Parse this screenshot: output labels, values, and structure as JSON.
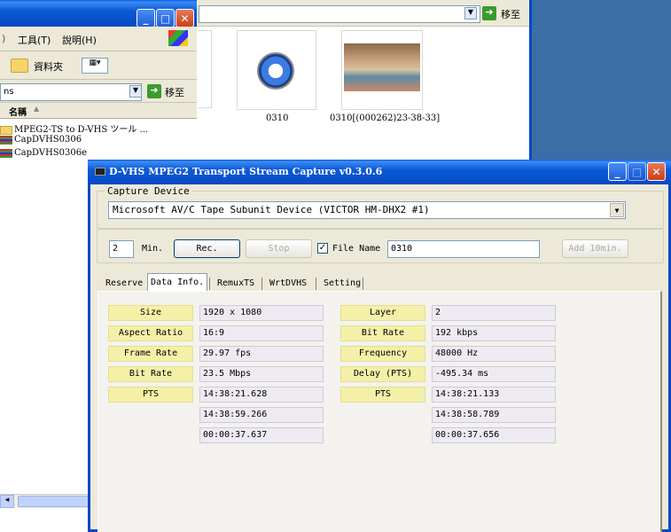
{
  "explorer": {
    "menu": {
      "tools": "工具(T)",
      "help": "說明(H)"
    },
    "toolbar": {
      "folders": "資料夾"
    },
    "address": {
      "value": "ns",
      "go": "移至"
    },
    "list_header": "名稱",
    "items": [
      {
        "label": "MPEG2-TS to D-VHS ツール ..."
      },
      {
        "label": "CapDVHS0306"
      },
      {
        "label": "CapDVHS0306e"
      }
    ]
  },
  "folder_window": {
    "go": "移至",
    "files": [
      {
        "label": "0310"
      },
      {
        "label": "0310[(000262)23-38-33]"
      }
    ]
  },
  "dialog": {
    "title": "D-VHS MPEG2 Transport Stream Capture v0.3.0.6",
    "capture_device": {
      "legend": "Capture Device",
      "value": "Microsoft AV/C Tape Subunit Device (VICTOR HM-DHX2 #1)"
    },
    "controls": {
      "minutes": "2",
      "min_label": "Min.",
      "rec": "Rec.",
      "stop": "Stop",
      "file_name_label": "File Name",
      "file_name_checked": true,
      "file_name_value": "0310",
      "add_10min": "Add 10min."
    },
    "tabs": [
      "Reserve",
      "Data Info.",
      "RemuxTS",
      "WrtDVHS",
      "Setting"
    ],
    "active_tab": "Data Info.",
    "video": {
      "size_label": "Size",
      "size": "1920 x 1080",
      "aspect_label": "Aspect Ratio",
      "aspect": "16:9",
      "frame_rate_label": "Frame Rate",
      "frame_rate": "29.97 fps",
      "bit_rate_label": "Bit Rate",
      "bit_rate": "23.5 Mbps",
      "pts_label": "PTS",
      "pts_start": "14:38:21.628",
      "pts_end": "14:38:59.266",
      "pts_duration": "00:00:37.637"
    },
    "audio": {
      "layer_label": "Layer",
      "layer": "2",
      "bit_rate_label": "Bit Rate",
      "bit_rate": "192 kbps",
      "frequency_label": "Frequency",
      "frequency": "48000 Hz",
      "delay_label": "Delay (PTS)",
      "delay": "-495.34 ms",
      "pts_label": "PTS",
      "pts_start": "14:38:21.133",
      "pts_end": "14:38:58.789",
      "pts_duration": "00:00:37.656"
    }
  },
  "colors": {
    "title_blue": "#0848c4",
    "label_yellow": "#f4f0a8",
    "dialog_bg": "#ece9d8"
  }
}
